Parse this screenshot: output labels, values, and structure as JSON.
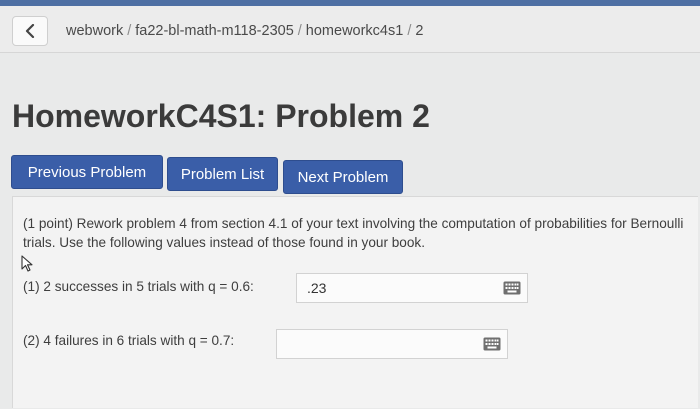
{
  "breadcrumb": {
    "items": [
      "webwork",
      "fa22-bl-math-m118-2305",
      "homeworkc4s1",
      "2"
    ],
    "separator": "/"
  },
  "page": {
    "title": "HomeworkC4S1: Problem 2"
  },
  "nav": {
    "previous_label": "Previous Problem",
    "list_label": "Problem List",
    "next_label": "Next Problem"
  },
  "problem": {
    "intro": "(1 point) Rework problem 4 from section 4.1 of your text involving the computation of probabilities for Bernoulli trials. Use the following values instead of those found in your book.",
    "parts": [
      {
        "label": "(1) 2 successes in 5 trials with q = 0.6:",
        "answer": ".23"
      },
      {
        "label": "(2) 4 failures in 6 trials with q = 0.7:",
        "answer": ""
      }
    ]
  },
  "icons": {
    "back": "chevron-left-icon",
    "keyboard": "keyboard-icon",
    "cursor": "mouse-cursor-icon"
  },
  "colors": {
    "accent": "#3a5ea8",
    "topstrip": "#4e6fa3"
  }
}
